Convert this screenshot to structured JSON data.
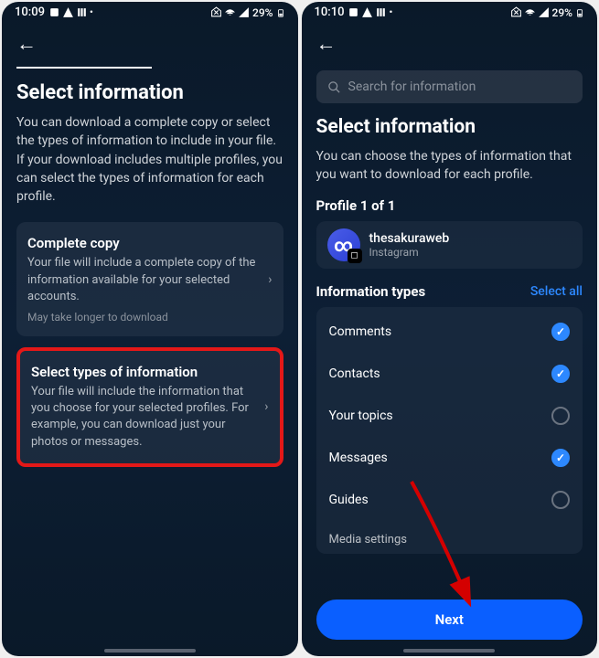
{
  "left": {
    "statusbar": {
      "time": "10:09",
      "battery": "29%"
    },
    "title": "Select information",
    "subtitle": "You can download a complete copy or select the types of information to include in your file. If your download includes multiple profiles, you can select the types of information for each profile.",
    "options": [
      {
        "title": "Complete copy",
        "desc": "Your file will include a complete copy of the information available for your selected accounts.",
        "note": "May take longer to download"
      },
      {
        "title": "Select types of information",
        "desc": "Your file will include the information that you choose for your selected profiles. For example, you can download just your photos or messages."
      }
    ]
  },
  "right": {
    "statusbar": {
      "time": "10:10",
      "battery": "29%"
    },
    "search_placeholder": "Search for information",
    "title": "Select information",
    "subtitle": "You can choose the types of information that you want to download for each profile.",
    "profile_section": "Profile 1 of 1",
    "profile_name": "thesakuraweb",
    "profile_platform": "Instagram",
    "info_header": "Information types",
    "select_all": "Select all",
    "items": [
      {
        "label": "Comments",
        "checked": true
      },
      {
        "label": "Contacts",
        "checked": true
      },
      {
        "label": "Your topics",
        "checked": false
      },
      {
        "label": "Messages",
        "checked": true
      },
      {
        "label": "Guides",
        "checked": false
      },
      {
        "label": "Media settings",
        "checked": false
      }
    ],
    "next_label": "Next"
  }
}
